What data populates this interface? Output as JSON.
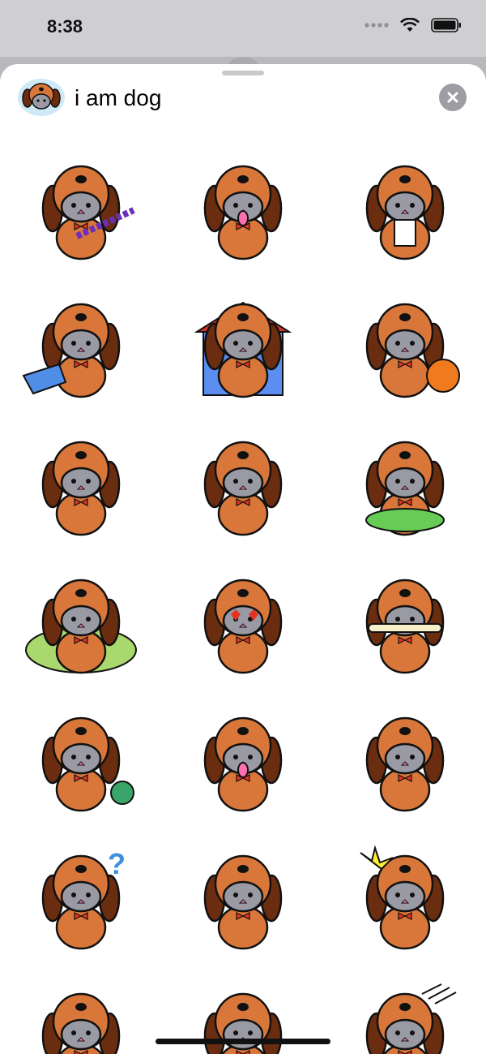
{
  "status_bar": {
    "time": "8:38"
  },
  "pack": {
    "title": "i am dog"
  },
  "colors": {
    "fur": "#d9773a",
    "ear": "#6b2d10",
    "face": "#9a9aa4",
    "bowtie": "#e53223",
    "outline": "#111111",
    "house_blue": "#5b8ef0",
    "roof_red": "#d8322b",
    "bowl_green": "#66cc55",
    "pumpkin": "#f07a1e",
    "yarn": "#3aa56a",
    "question": "#3d8fe0",
    "burst": "#ffee33"
  },
  "stickers": [
    {
      "name": "sticker-dog-tug-rope",
      "prop": "rope-icon"
    },
    {
      "name": "sticker-dog-tongue-out",
      "prop": "tongue-icon"
    },
    {
      "name": "sticker-dog-tuxedo",
      "prop": "tuxedo-icon"
    },
    {
      "name": "sticker-dog-litter-box",
      "prop": "litter-box-icon"
    },
    {
      "name": "sticker-dog-doghouse",
      "prop": "doghouse-icon"
    },
    {
      "name": "sticker-dog-pumpkin-basket",
      "prop": "pumpkin-icon"
    },
    {
      "name": "sticker-dog-sitting",
      "prop": "none"
    },
    {
      "name": "sticker-dog-side-standing",
      "prop": "none"
    },
    {
      "name": "sticker-dog-water-bowl",
      "prop": "bowl-icon"
    },
    {
      "name": "sticker-dog-bed",
      "prop": "dog-bed-icon"
    },
    {
      "name": "sticker-dog-heart-eyes",
      "prop": "heart-icon"
    },
    {
      "name": "sticker-dog-bone-mouth",
      "prop": "bone-icon"
    },
    {
      "name": "sticker-dog-yarn-ball",
      "prop": "yarn-icon"
    },
    {
      "name": "sticker-dog-sitting-tongue",
      "prop": "tongue-icon"
    },
    {
      "name": "sticker-dog-rolling-over",
      "prop": "none"
    },
    {
      "name": "sticker-dog-question",
      "prop": "question-mark-icon"
    },
    {
      "name": "sticker-dog-smiling",
      "prop": "none"
    },
    {
      "name": "sticker-dog-surprised",
      "prop": "burst-icon"
    },
    {
      "name": "sticker-dog-box",
      "prop": "box-icon"
    },
    {
      "name": "sticker-dog-wagging",
      "prop": "none"
    },
    {
      "name": "sticker-dog-shaking",
      "prop": "motion-lines-icon"
    }
  ]
}
